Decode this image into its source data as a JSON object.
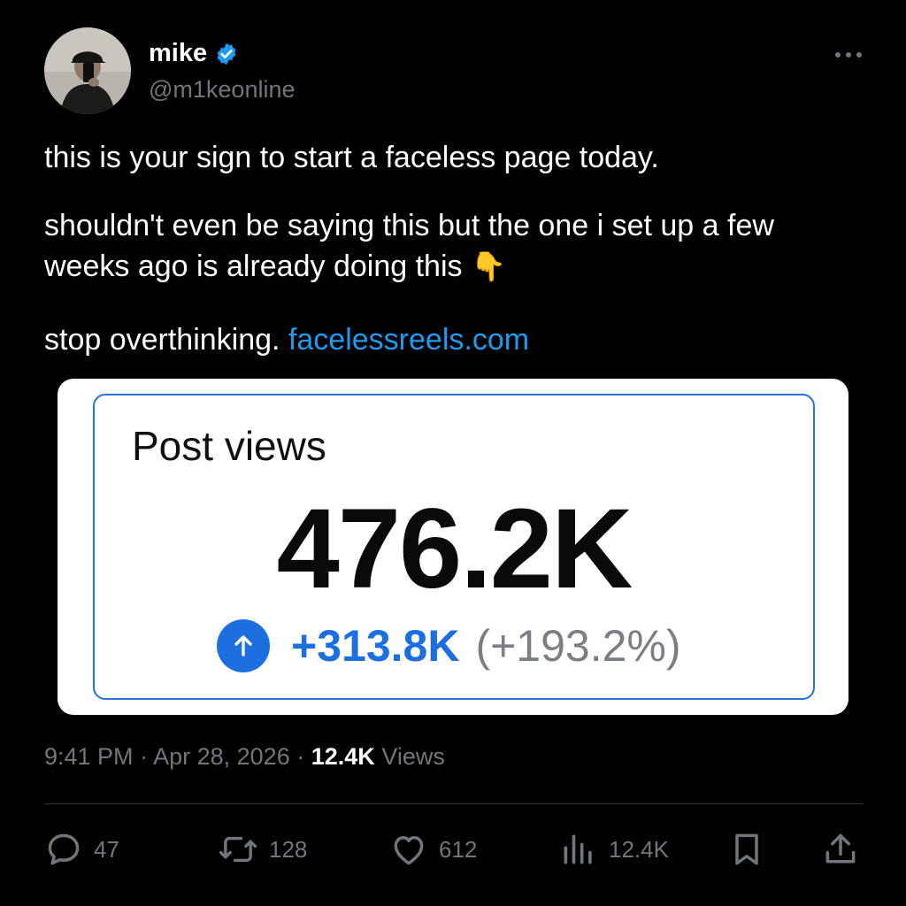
{
  "author": {
    "name": "mike",
    "handle": "@m1keonline",
    "verified": true,
    "verified_color": "#1d9bf0"
  },
  "tweet": {
    "line1": "this is your sign to start a faceless page today.",
    "line2": "shouldn't even be saying this but the one i set up a few weeks ago is already doing this",
    "line2_emoji": "👇",
    "line3": "stop overthinking.",
    "link": "facelessreels.com"
  },
  "card": {
    "title": "Post views",
    "value": "476.2K",
    "delta": "+313.8K",
    "delta_percent": "(+193.2%)",
    "accent_color": "#1d6fe0"
  },
  "meta": {
    "time": "9:41 PM",
    "separator": "·",
    "date": "Apr 28, 2026",
    "views_count": "12.4K",
    "views_label": "Views"
  },
  "actions": {
    "replies": "47",
    "reposts": "128",
    "likes": "612",
    "views": "12.4K"
  },
  "icons": [
    "more-icon",
    "verified-badge-icon",
    "reply-icon",
    "repost-icon",
    "like-icon",
    "views-icon",
    "bookmark-icon",
    "share-icon",
    "arrow-up-icon"
  ]
}
